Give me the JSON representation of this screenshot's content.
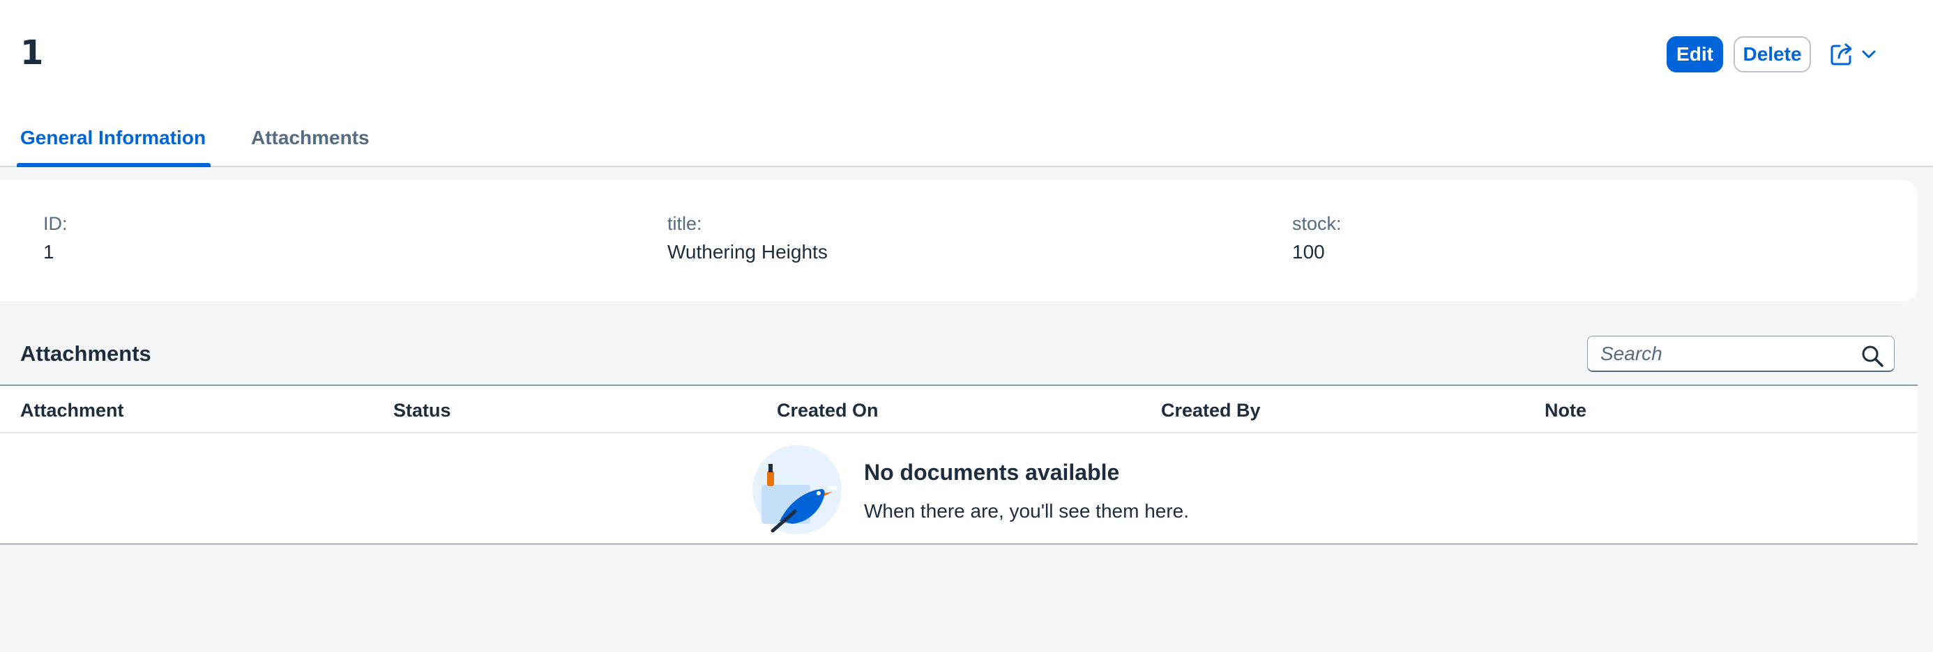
{
  "header": {
    "title": "1",
    "actions": {
      "edit_label": "Edit",
      "delete_label": "Delete"
    }
  },
  "tabs": [
    {
      "label": "General Information",
      "selected": true
    },
    {
      "label": "Attachments",
      "selected": false
    }
  ],
  "general_info": {
    "fields": [
      {
        "label": "ID:",
        "value": "1"
      },
      {
        "label": "title:",
        "value": "Wuthering Heights"
      },
      {
        "label": "stock:",
        "value": "100"
      }
    ]
  },
  "attachments": {
    "title": "Attachments",
    "search_placeholder": "Search",
    "columns": [
      "Attachment",
      "Status",
      "Created On",
      "Created By",
      "Note"
    ],
    "empty_title": "No documents available",
    "empty_description": "When there are, you'll see them here."
  },
  "icons": {
    "share": "share-icon",
    "menu": "chevron-down-icon",
    "search": "search-icon",
    "empty": "no-data-illustration"
  },
  "colors": {
    "accent": "#0064d9",
    "text": "#1d2d3e",
    "secondary_text": "#556b82",
    "background": "#f5f6f7"
  }
}
